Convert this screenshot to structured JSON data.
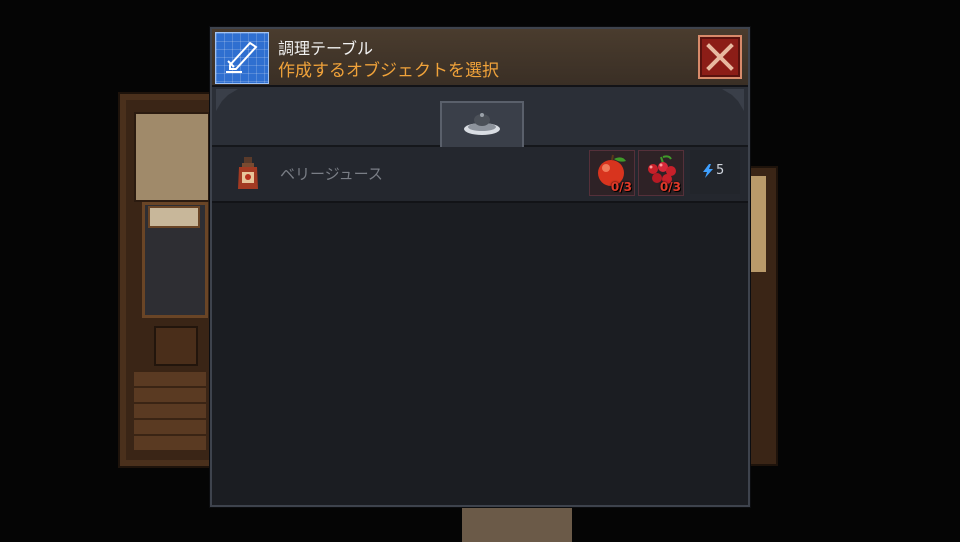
{
  "dialog": {
    "title": "調理テーブル",
    "subtitle": "作成するオブジェクトを選択",
    "icon": "blueprint-knife-icon",
    "close_icon": "close-x-icon"
  },
  "tabs": [
    {
      "icon": "cooking-pot-icon",
      "active": true
    }
  ],
  "recipes": [
    {
      "name": "ベリージュース",
      "icon": "juice-bottle-icon",
      "ingredients": [
        {
          "icon": "apple-icon",
          "count": "0/3"
        },
        {
          "icon": "red-berries-icon",
          "count": "0/3"
        }
      ],
      "energy_icon": "lightning-icon",
      "energy": "5"
    }
  ],
  "colors": {
    "title": "#f2f2f2",
    "subtitle": "#f0a23a",
    "count_insufficient": "#e03a2a",
    "close_button": "#8c1d17",
    "energy_bolt": "#3fa0ff"
  }
}
